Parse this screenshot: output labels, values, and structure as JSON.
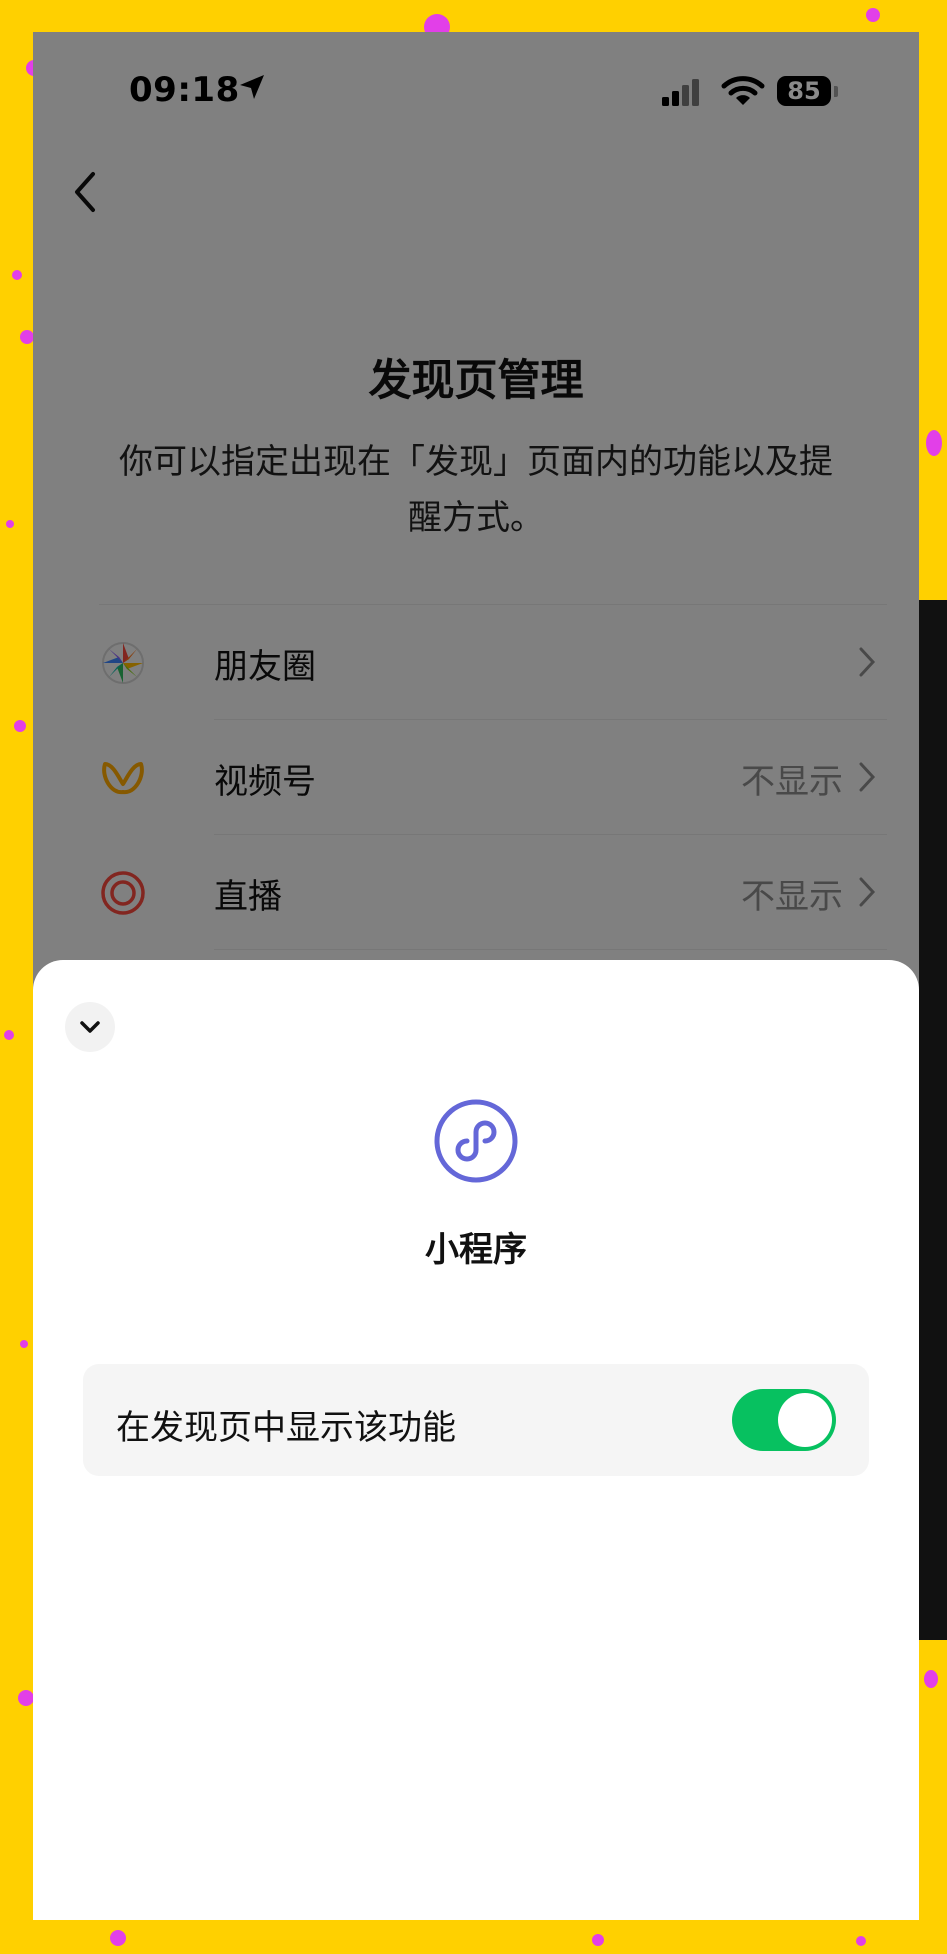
{
  "status_bar": {
    "time": "09:18",
    "battery": "85"
  },
  "page": {
    "title": "发现页管理",
    "description": "你可以指定出现在「发现」页面内的功能以及提醒方式。"
  },
  "list": {
    "items": [
      {
        "label": "朋友圈",
        "value": "",
        "icon": "moments-icon"
      },
      {
        "label": "视频号",
        "value": "不显示",
        "icon": "channels-icon"
      },
      {
        "label": "直播",
        "value": "不显示",
        "icon": "live-icon"
      }
    ]
  },
  "sheet": {
    "title": "小程序",
    "icon": "mini-program-icon",
    "setting_label": "在发现页中显示该功能",
    "toggle_on": true
  },
  "colors": {
    "accent_green": "#07C160",
    "mini_program_purple": "#6467D8",
    "background": "#FFD000"
  }
}
